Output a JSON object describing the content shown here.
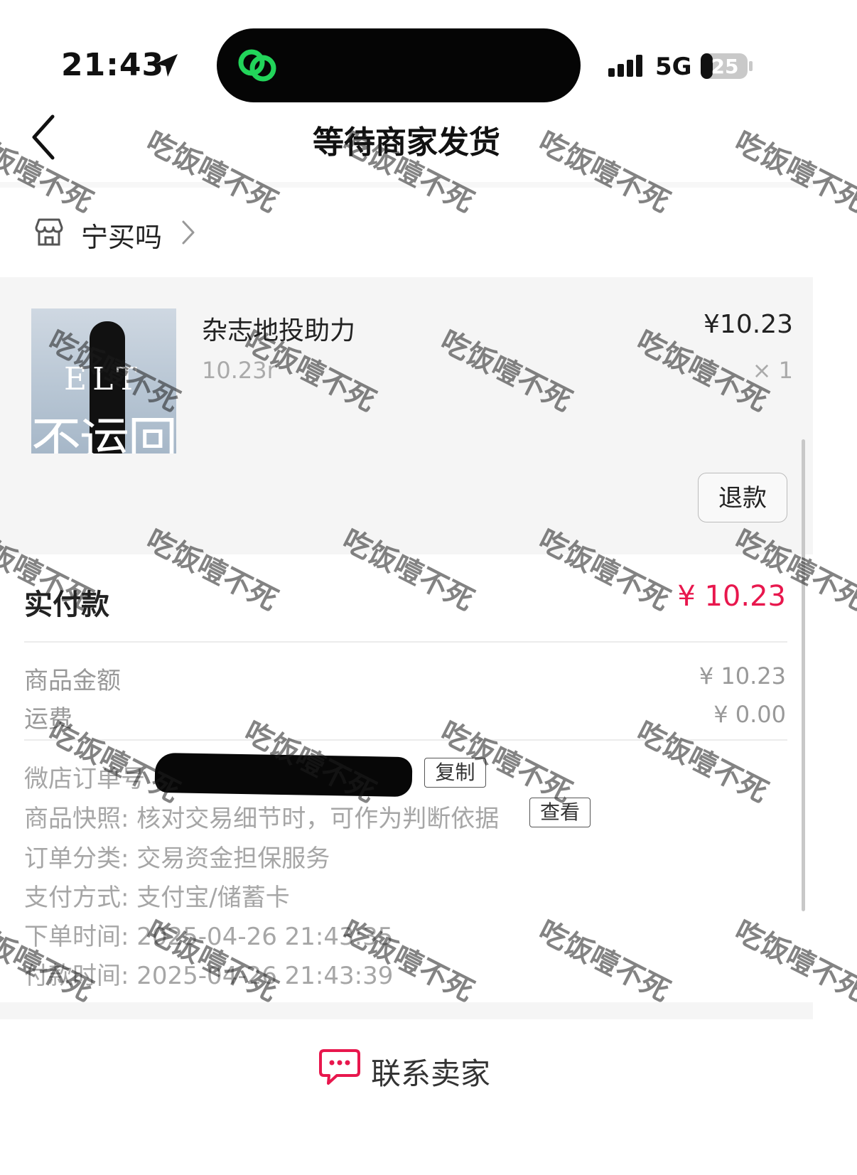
{
  "status_bar": {
    "time": "21:43",
    "network": "5G",
    "battery": "25",
    "icons": [
      "location-arrow-icon",
      "link-rings-icon",
      "signal-icon",
      "battery-icon"
    ]
  },
  "nav": {
    "title": "等待商家发货",
    "back_icon": "chevron-left-icon"
  },
  "store": {
    "name": "宁买吗",
    "icon": "store-icon"
  },
  "product": {
    "title": "杂志地投助力",
    "spec": "10.23r",
    "price": "¥10.23",
    "quantity": "× 1",
    "cover_text_latin": "ELT",
    "cover_text_cn": "不运回",
    "refund_label": "退款"
  },
  "summary": {
    "paid_label": "实付款",
    "paid_value": "¥ 10.23",
    "goods_label": "商品金额",
    "goods_value": "¥ 10.23",
    "shipping_label": "运费",
    "shipping_value": "¥ 0.00"
  },
  "details": {
    "order_no_label": "微店订单号",
    "copy_label": "复制",
    "snapshot_text": "商品快照: 核对交易细节时，可作为判断依据",
    "view_label": "查看",
    "category": "订单分类:  交易资金担保服务",
    "payment": "支付方式:  支付宝/储蓄卡",
    "order_time": "下单时间:  2025-04-26 21:43:35",
    "pay_time": "付款时间:  2025-04-26 21:43:39"
  },
  "footer": {
    "contact_label": "联系卖家",
    "icon": "chat-bubble-icon"
  },
  "watermark": "吃饭噎不死",
  "colors": {
    "accent_price": "#e8174d",
    "chat_icon": "#e8174d",
    "island_icon": "#22d45a"
  }
}
